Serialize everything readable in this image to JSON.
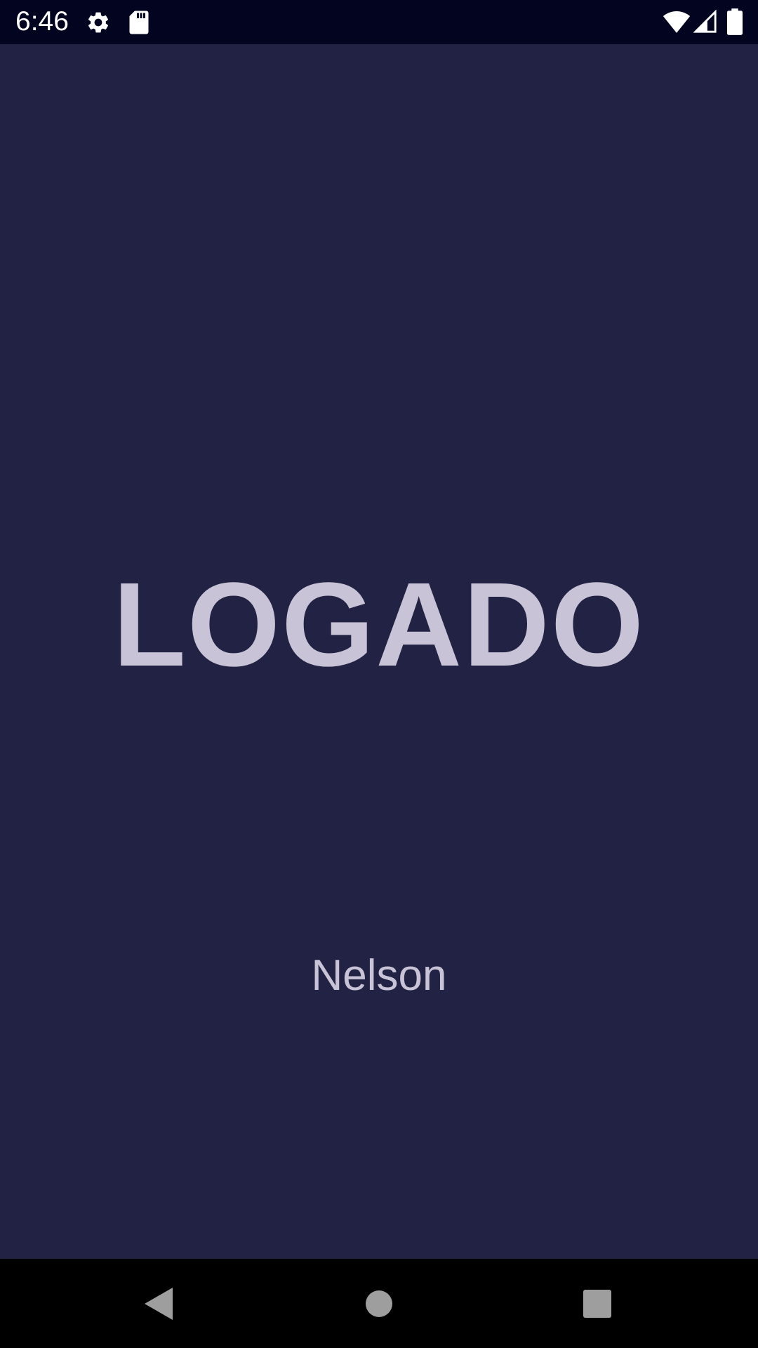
{
  "status_bar": {
    "time": "6:46",
    "icons": [
      "gear-icon",
      "sd-card-icon",
      "wifi-icon",
      "cellular-signal-icon",
      "battery-icon"
    ]
  },
  "main": {
    "title": "LOGADO",
    "user_name": "Nelson"
  },
  "nav_bar": {
    "buttons": [
      "back-icon",
      "home-icon",
      "recents-icon"
    ]
  },
  "colors": {
    "background": "#222244",
    "status_bar": "#03041f",
    "text": "#c8c3d6",
    "nav_bar": "#000000",
    "nav_icons": "#9e9e9e"
  }
}
